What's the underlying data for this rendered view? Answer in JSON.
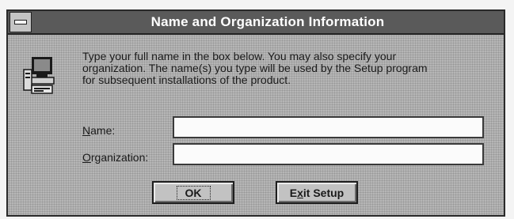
{
  "window": {
    "title": "Name and Organization Information"
  },
  "message": {
    "line1": "Type your full name in the box below. You may also specify your",
    "line2": "organization. The name(s) you type will be used by the Setup program",
    "line3": "for subsequent installations of the product."
  },
  "form": {
    "name_label_mnemonic": "N",
    "name_label_rest": "ame:",
    "name_value": "",
    "organization_label_mnemonic": "O",
    "organization_label_rest": "rganization:",
    "organization_value": ""
  },
  "buttons": {
    "ok_label": "OK",
    "exit_mnemonic_pre": "E",
    "exit_mnemonic": "x",
    "exit_rest": "it Setup"
  },
  "icons": {
    "system_menu": "system-menu-icon",
    "setup": "computer-setup-icon"
  }
}
